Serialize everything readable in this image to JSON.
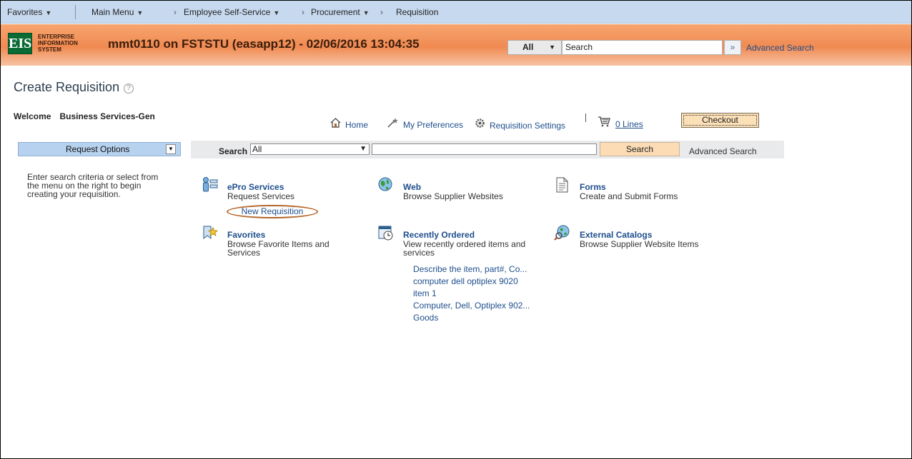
{
  "topnav": {
    "favorites": "Favorites",
    "main_menu": "Main Menu",
    "ess": "Employee Self-Service",
    "procurement": "Procurement",
    "requisition": "Requisition"
  },
  "banner": {
    "logo": "EIS",
    "logo_line1": "ENTERPRISE",
    "logo_line2": "INFORMATION",
    "logo_line3": "SYSTEM",
    "title": "mmt0110 on FSTSTU (easapp12) - 02/06/2016 13:04:35",
    "scope": "All",
    "search_value": "Search",
    "go": "»",
    "advanced_search": "Advanced Search"
  },
  "page": {
    "title": "Create Requisition",
    "help": "?",
    "welcome_label": "Welcome",
    "welcome_name": "Business Services-Gen"
  },
  "toolbar": {
    "home": "Home",
    "preferences": "My Preferences",
    "settings": "Requisition Settings",
    "lines": "0 Lines",
    "checkout": "Checkout"
  },
  "search": {
    "request_options": "Request Options",
    "label": "Search",
    "scope": "All",
    "button": "Search",
    "advanced": "Advanced Search"
  },
  "intro": "Enter search criteria or select from the menu on the right to begin creating your requisition.",
  "tiles": {
    "epro": {
      "title": "ePro Services",
      "desc": "Request Services",
      "link": "New Requisition"
    },
    "web": {
      "title": "Web",
      "desc": "Browse Supplier Websites"
    },
    "forms": {
      "title": "Forms",
      "desc": "Create and Submit Forms"
    },
    "favorites": {
      "title": "Favorites",
      "desc1": "Browse Favorite Items and",
      "desc2": "Services"
    },
    "recent": {
      "title": "Recently Ordered",
      "desc1": "View recently ordered items and",
      "desc2": "services",
      "items": [
        "Describe the item, part#, Co...",
        "computer dell optiplex 9020",
        "item 1",
        "Computer, Dell, Optiplex 902...",
        "Goods"
      ]
    },
    "external": {
      "title": "External Catalogs",
      "desc": "Browse Supplier Website Items"
    }
  }
}
